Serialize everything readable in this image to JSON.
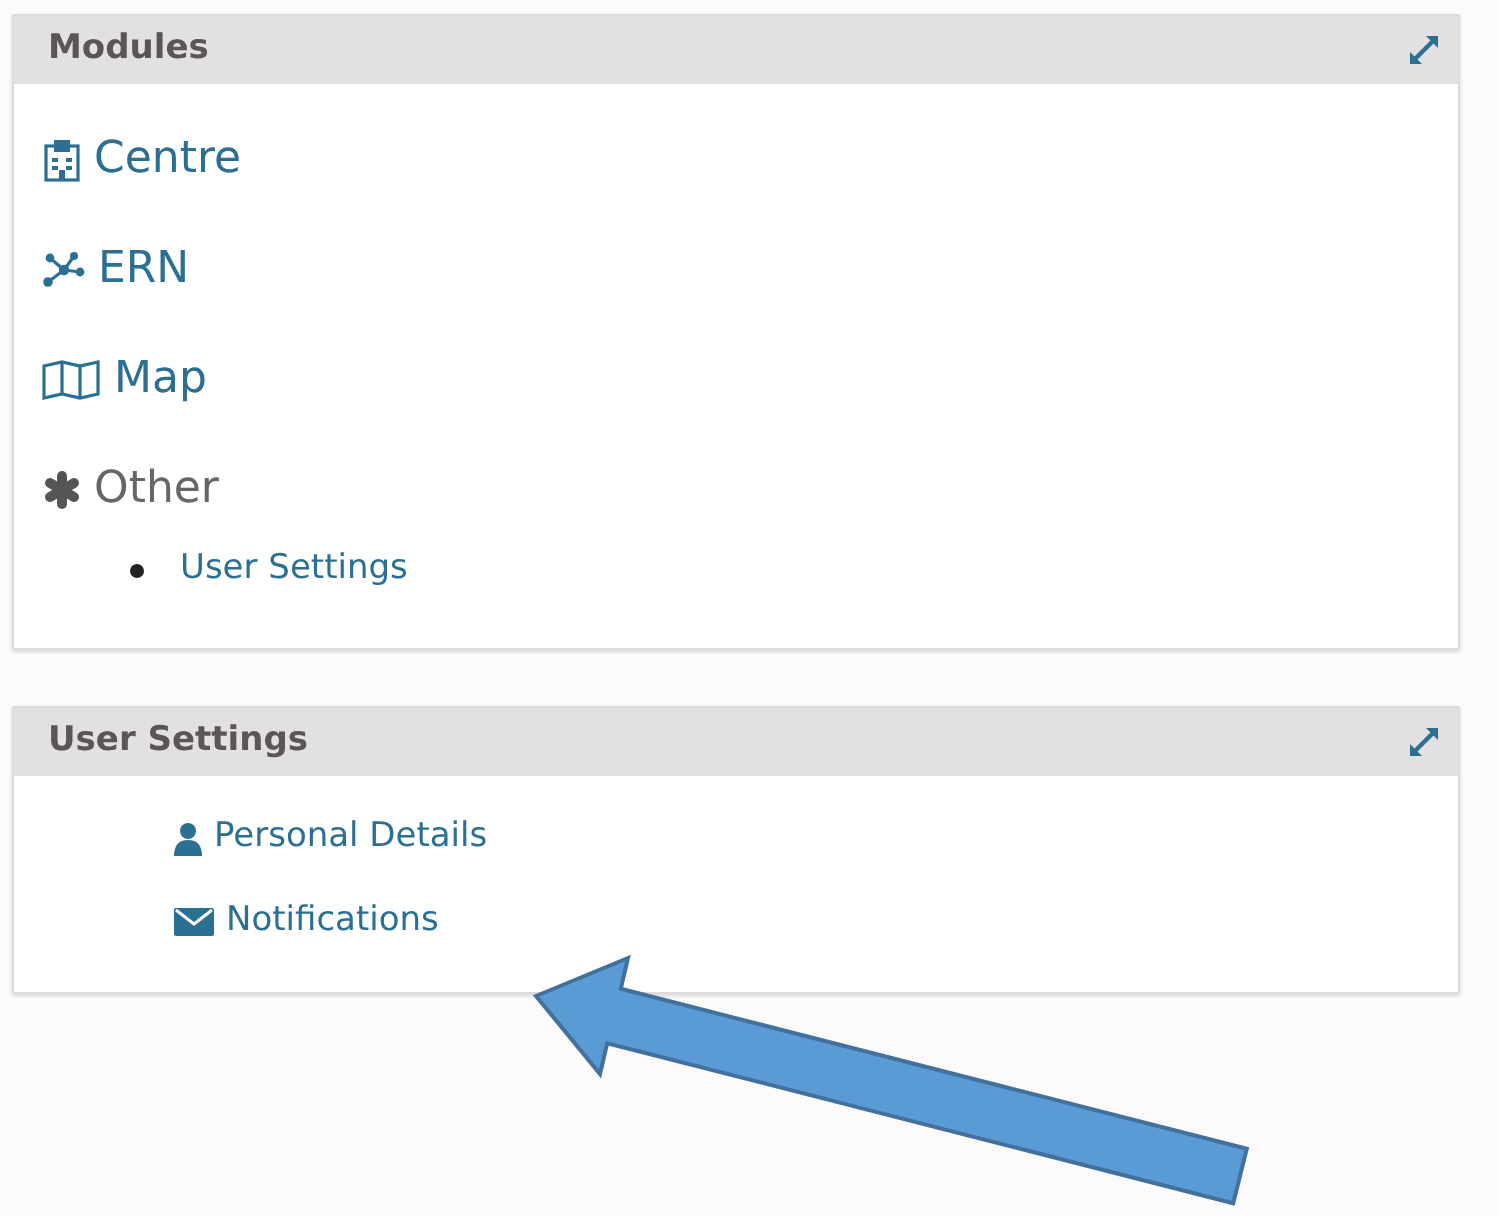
{
  "panels": [
    {
      "title": "Modules",
      "kind": "modules",
      "items": [
        {
          "label": "Centre",
          "kind": "link"
        },
        {
          "label": "ERN",
          "kind": "link"
        },
        {
          "label": "Map",
          "kind": "link"
        },
        {
          "label": "Other",
          "kind": "group",
          "children": [
            {
              "label": "User Settings"
            }
          ]
        }
      ]
    },
    {
      "title": "User Settings",
      "kind": "settings",
      "items": [
        {
          "label": "Personal Details",
          "kind": "link"
        },
        {
          "label": "Notifications",
          "kind": "link"
        }
      ]
    }
  ]
}
